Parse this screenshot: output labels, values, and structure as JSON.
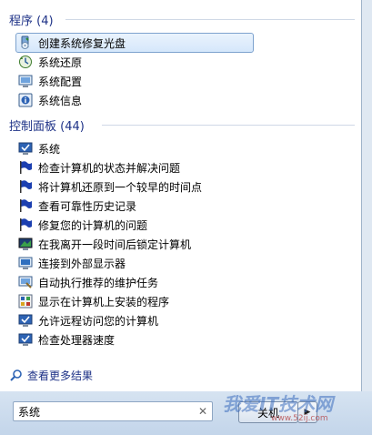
{
  "programs": {
    "title": "程序 (4)",
    "items": [
      {
        "label": "创建系统修复光盘",
        "icon": "disc-repair-icon",
        "selected": true
      },
      {
        "label": "系统还原",
        "icon": "system-restore-icon"
      },
      {
        "label": "系统配置",
        "icon": "system-config-icon"
      },
      {
        "label": "系统信息",
        "icon": "system-info-icon"
      }
    ]
  },
  "control_panel": {
    "title": "控制面板 (44)",
    "items": [
      {
        "label": "系统",
        "icon": "system-monitor-check-icon"
      },
      {
        "label": "检查计算机的状态并解决问题",
        "icon": "action-center-flag-icon"
      },
      {
        "label": "将计算机还原到一个较早的时间点",
        "icon": "action-center-flag-icon"
      },
      {
        "label": "查看可靠性历史记录",
        "icon": "action-center-flag-icon"
      },
      {
        "label": "修复您的计算机的问题",
        "icon": "action-center-flag-icon"
      },
      {
        "label": "在我离开一段时间后锁定计算机",
        "icon": "screensaver-icon"
      },
      {
        "label": "连接到外部显示器",
        "icon": "display-icon"
      },
      {
        "label": "自动执行推荐的维护任务",
        "icon": "troubleshoot-icon"
      },
      {
        "label": "显示在计算机上安装的程序",
        "icon": "programs-icon"
      },
      {
        "label": "允许远程访问您的计算机",
        "icon": "system-monitor-check-icon"
      },
      {
        "label": "检查处理器速度",
        "icon": "system-monitor-check-icon"
      }
    ]
  },
  "more_results": "查看更多结果",
  "search": {
    "value": "系统"
  },
  "shutdown_label": "关机",
  "watermark": {
    "text": "我爱IT技术网",
    "url": "www.52ij.com"
  },
  "colors": {
    "accent": "#1e3287",
    "selection": "#d5e7fb",
    "flag": "#1b3fb0"
  }
}
